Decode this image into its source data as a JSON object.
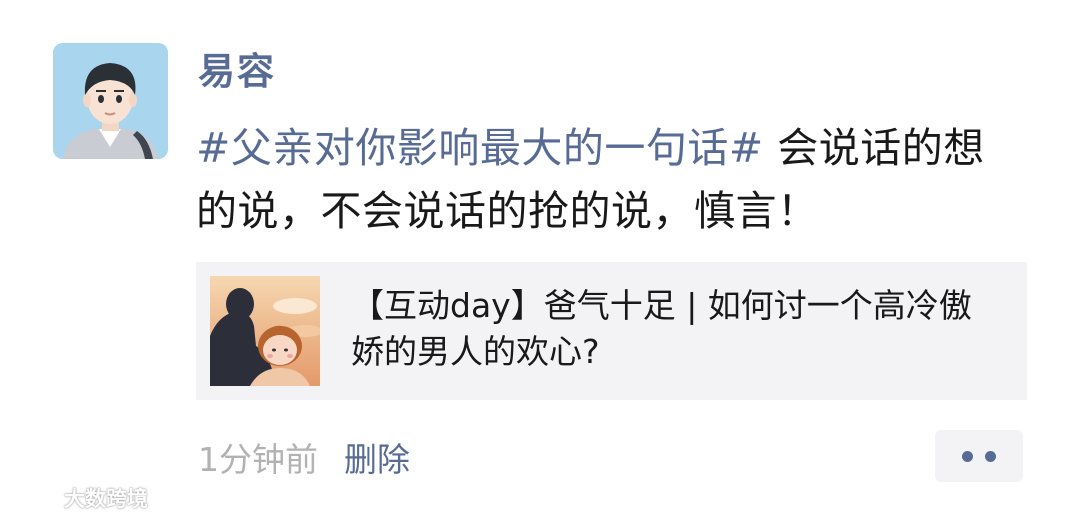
{
  "post": {
    "author": "易容",
    "topic": "#父亲对你影响最大的一句话#",
    "body": " 会说话的想的说，不会说话的抢的说，慎言！",
    "link_card": {
      "title": "【互动day】爸气十足 | 如何讨一个高冷傲娇的男人的欢心?"
    },
    "timestamp": "1分钟前",
    "delete_label": "删除"
  },
  "watermark": {
    "text": "大数跨境"
  },
  "colors": {
    "link_blue": "#576b95",
    "text": "#191919",
    "muted": "#b2b2b2",
    "card_bg": "#f3f3f5"
  }
}
